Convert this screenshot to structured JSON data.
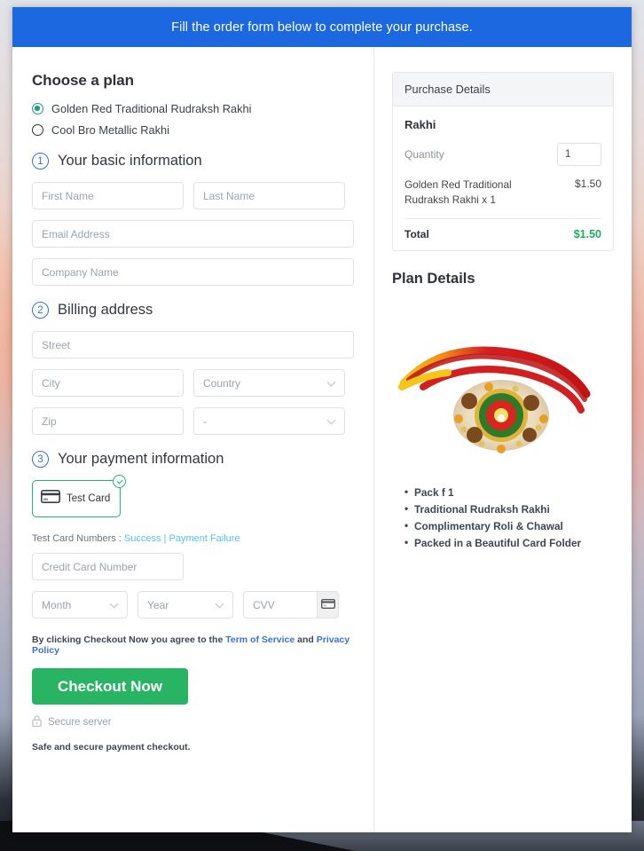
{
  "banner": {
    "text": "Fill the order form below to complete your purchase."
  },
  "plan_section": {
    "heading": "Choose a plan",
    "options": [
      {
        "label": "Golden Red Traditional Rudraksh Rakhi",
        "selected": true
      },
      {
        "label": "Cool Bro Metallic Rakhi",
        "selected": false
      }
    ]
  },
  "step1": {
    "number": "1",
    "title": "Your basic information",
    "first_name_placeholder": "First Name",
    "last_name_placeholder": "Last Name",
    "email_placeholder": "Email Address",
    "company_placeholder": "Company Name"
  },
  "step2": {
    "number": "2",
    "title": "Billing address",
    "street_placeholder": "Street",
    "city_placeholder": "City",
    "country_value": "Country",
    "zip_placeholder": "Zip",
    "state_value": "-"
  },
  "step3": {
    "number": "3",
    "title": "Your payment information",
    "test_card_label": "Test Card",
    "test_numbers_prefix": "Test Card Numbers : ",
    "test_numbers_success": "Success",
    "test_numbers_separator": " | ",
    "test_numbers_failure": "Payment Failure",
    "card_number_placeholder": "Credit Card Number",
    "month_value": "Month",
    "year_value": "Year",
    "cvv_placeholder": "CVV"
  },
  "footer": {
    "terms_prefix": "By clicking Checkout Now you agree to the ",
    "terms_link": "Term of Service",
    "terms_middle": " and ",
    "privacy_link": "Privacy Policy",
    "checkout_label": "Checkout Now",
    "secure_server": "Secure server",
    "safe_note": "Safe and secure payment checkout."
  },
  "purchase_details": {
    "header": "Purchase Details",
    "product_title": "Rakhi",
    "quantity_label": "Quantity",
    "quantity_value": "1",
    "line_item_desc": "Golden Red Traditional Rudraksh Rakhi x 1",
    "line_item_amount": "$1.50",
    "total_label": "Total",
    "total_amount": "$1.50"
  },
  "plan_details": {
    "heading": "Plan Details",
    "features": [
      "Pack f 1",
      "Traditional Rudraksh Rakhi",
      "Complimentary Roli & Chawal",
      "Packed in a Beautiful Card Folder"
    ]
  },
  "colors": {
    "banner_blue": "#1b68e0",
    "accent_green": "#28b463",
    "radio_green": "#1aa179",
    "link_cyan": "#55c4dd",
    "link_blue": "#3d6fd1",
    "total_green": "#1fae5a"
  }
}
